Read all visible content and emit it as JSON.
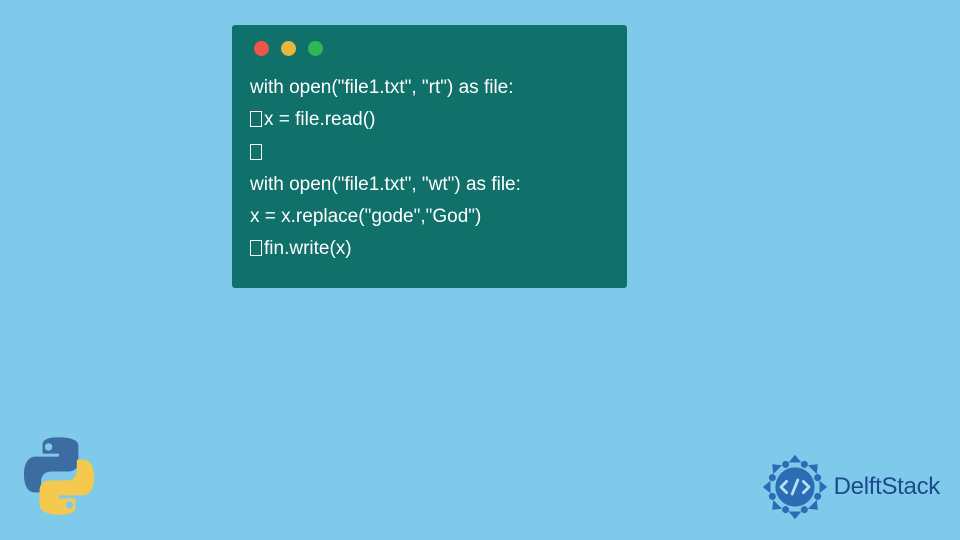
{
  "window": {
    "traffic_colors": {
      "red": "#ee5548",
      "yellow": "#e7b63f",
      "green": "#2db757"
    }
  },
  "code": {
    "line1": "with open(\"file1.txt\", \"rt\") as file:",
    "line2": "x = file.read()",
    "line4": "with open(\"file1.txt\", \"wt\") as file:",
    "line5": "    x = x.replace(\"gode\",\"God\")",
    "line6": "fin.write(x)"
  },
  "logos": {
    "brand": "DelftStack"
  },
  "colors": {
    "background": "#7fcaea",
    "window_bg": "#10706a",
    "code_text": "#ffffff",
    "brand_blue": "#1b4a8c",
    "python_blue": "#3b6da2",
    "python_yellow": "#f4c94e"
  }
}
